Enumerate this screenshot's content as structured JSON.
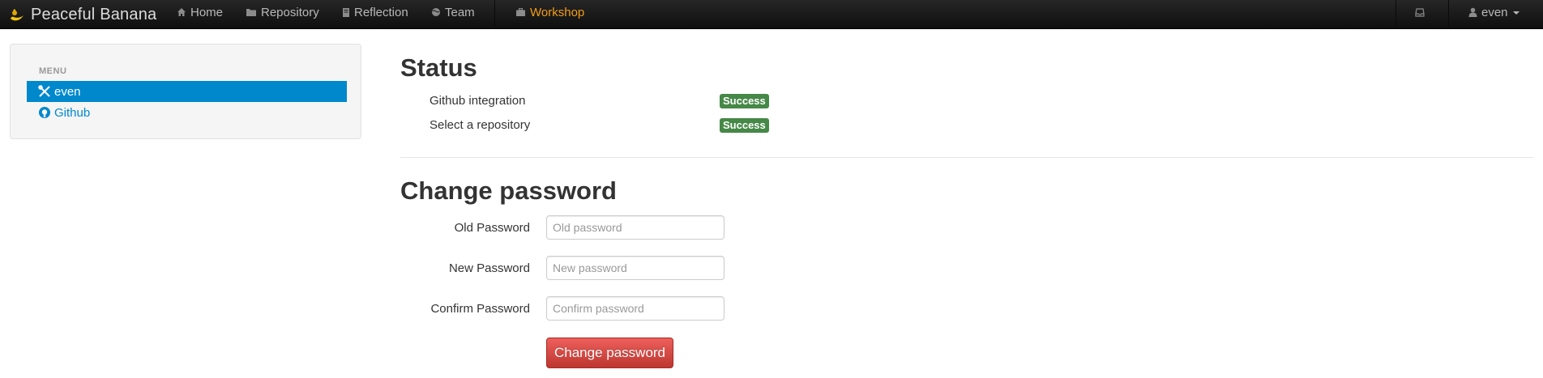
{
  "navbar": {
    "brand": "Peaceful Banana",
    "items": [
      {
        "label": "Home",
        "icon": "home-icon"
      },
      {
        "label": "Repository",
        "icon": "folder-icon"
      },
      {
        "label": "Reflection",
        "icon": "book-icon"
      },
      {
        "label": "Team",
        "icon": "globe-icon"
      },
      {
        "label": "Workshop",
        "icon": "briefcase-icon",
        "active": true
      }
    ],
    "user": "even",
    "colors": {
      "active": "#f39c12",
      "background": "#1b1b1b"
    }
  },
  "sidebar": {
    "header": "MENU",
    "items": [
      {
        "label": "even",
        "icon": "tools-icon",
        "active": true
      },
      {
        "label": "Github",
        "icon": "github-icon"
      }
    ],
    "colors": {
      "active_bg": "#0088cc"
    }
  },
  "status": {
    "title": "Status",
    "rows": [
      {
        "label": "Github integration",
        "badge": "Success"
      },
      {
        "label": "Select a repository",
        "badge": "Success"
      }
    ],
    "badge_color": "#468847"
  },
  "change_password": {
    "title": "Change password",
    "fields": [
      {
        "label": "Old Password",
        "placeholder": "Old password"
      },
      {
        "label": "New Password",
        "placeholder": "New password"
      },
      {
        "label": "Confirm Password",
        "placeholder": "Confirm password"
      }
    ],
    "submit_label": "Change password",
    "button_color": "#da4f49"
  }
}
